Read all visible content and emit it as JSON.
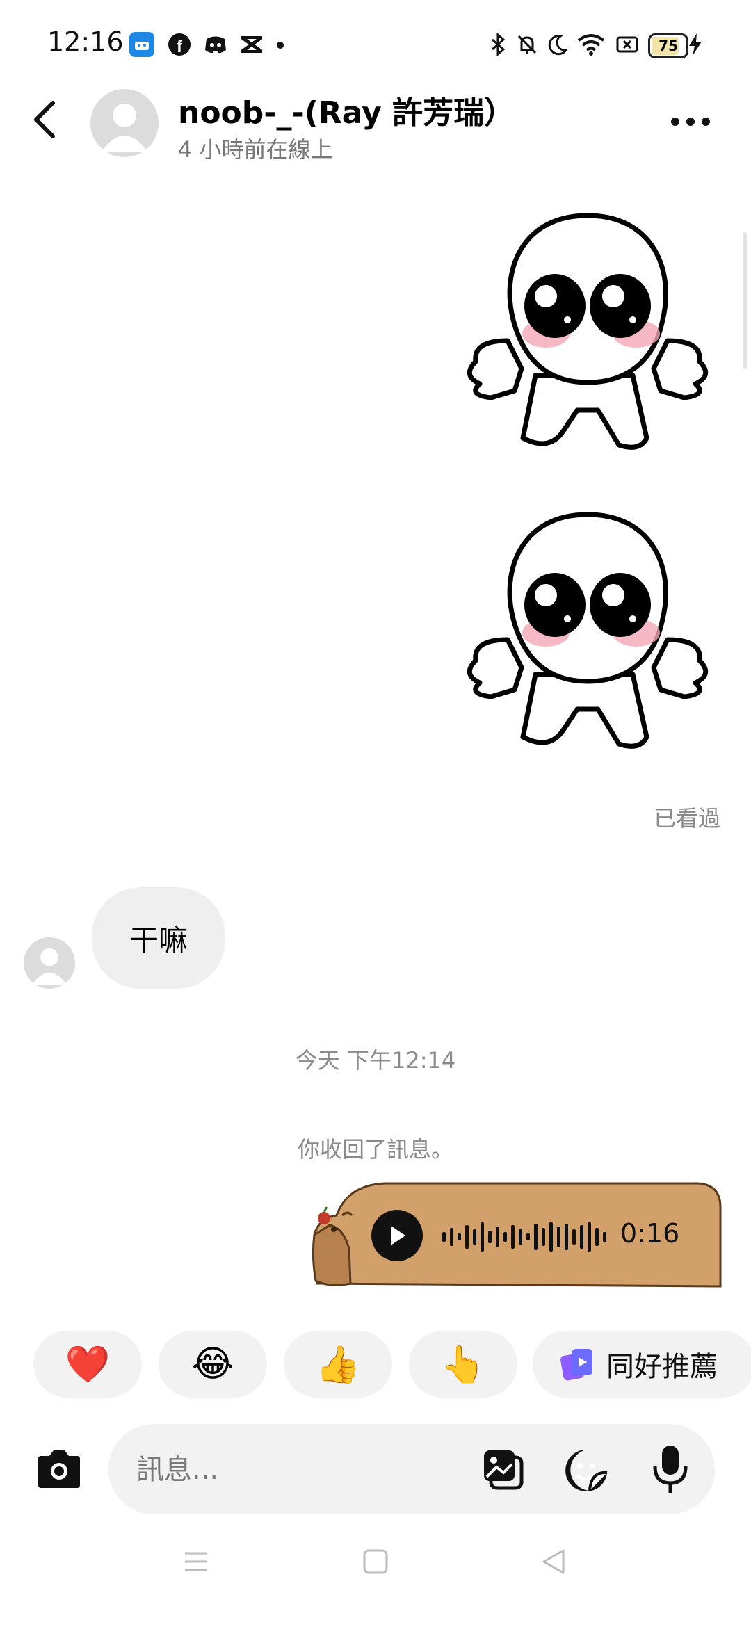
{
  "status_bar": {
    "time": "12:16",
    "battery": "75",
    "left_icons": [
      "app-icon",
      "facebook-icon",
      "discord-icon",
      "capcut-icon",
      "dot-icon"
    ],
    "right_icons": [
      "bluetooth-icon",
      "mute-icon",
      "moon-icon",
      "wifi-icon",
      "sim-icon",
      "battery-icon",
      "charging-icon"
    ]
  },
  "header": {
    "name": "noob-_-(Ray 許芳瑞）",
    "status": "4 小時前在線上"
  },
  "chat": {
    "seen": "已看過",
    "incoming_text": "干嘛",
    "date": "今天 下午12:14",
    "unsent": "你收回了訊息。",
    "voice_duration": "0:16"
  },
  "quick_reactions": {
    "items": [
      "❤️",
      "😂",
      "👍",
      "👆"
    ],
    "recommend_label": "同好推薦"
  },
  "composer": {
    "placeholder": "訊息..."
  },
  "colors": {
    "bubble_gray": "#efefef",
    "capybara_brown": "#d2a06a",
    "text_gray": "#8a8a8a"
  }
}
